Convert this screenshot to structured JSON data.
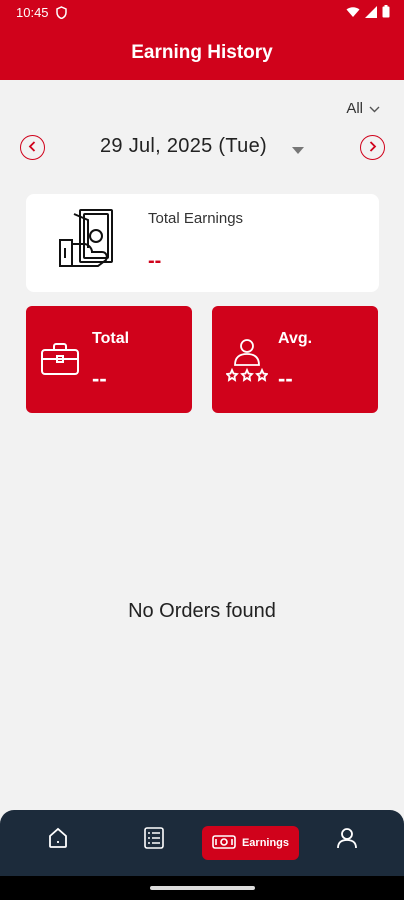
{
  "status_bar": {
    "time": "10:45",
    "icons": [
      "shield-icon",
      "wifi-icon",
      "signal-icon",
      "battery-icon"
    ]
  },
  "app_bar": {
    "title": "Earning History"
  },
  "filter": {
    "value": "All",
    "icon": "chevron-down-icon"
  },
  "date_nav": {
    "date": "29 Jul, 2025 (Tue)",
    "prev_icon": "chevron-left-icon",
    "next_icon": "chevron-right-icon",
    "dropdown_icon": "caret-down-icon"
  },
  "total_earnings": {
    "label": "Total Earnings",
    "value": "--",
    "icon": "cash-hand-icon"
  },
  "stats": {
    "total": {
      "label": "Total",
      "value": "--",
      "icon": "briefcase-icon"
    },
    "avg": {
      "label": "Avg.",
      "value": "--",
      "icon": "rating-person-icon"
    }
  },
  "empty_state": {
    "message": "No Orders found"
  },
  "bottom_nav": {
    "items": [
      {
        "id": "home",
        "icon": "home-icon"
      },
      {
        "id": "orders",
        "icon": "list-icon"
      },
      {
        "id": "earnings",
        "icon": "cash-icon",
        "label": "Earnings",
        "active": true
      },
      {
        "id": "profile",
        "icon": "user-icon"
      }
    ]
  },
  "colors": {
    "primary": "#d0021b",
    "nav_bg": "#1c2b3b",
    "background": "#f2f2f2"
  }
}
